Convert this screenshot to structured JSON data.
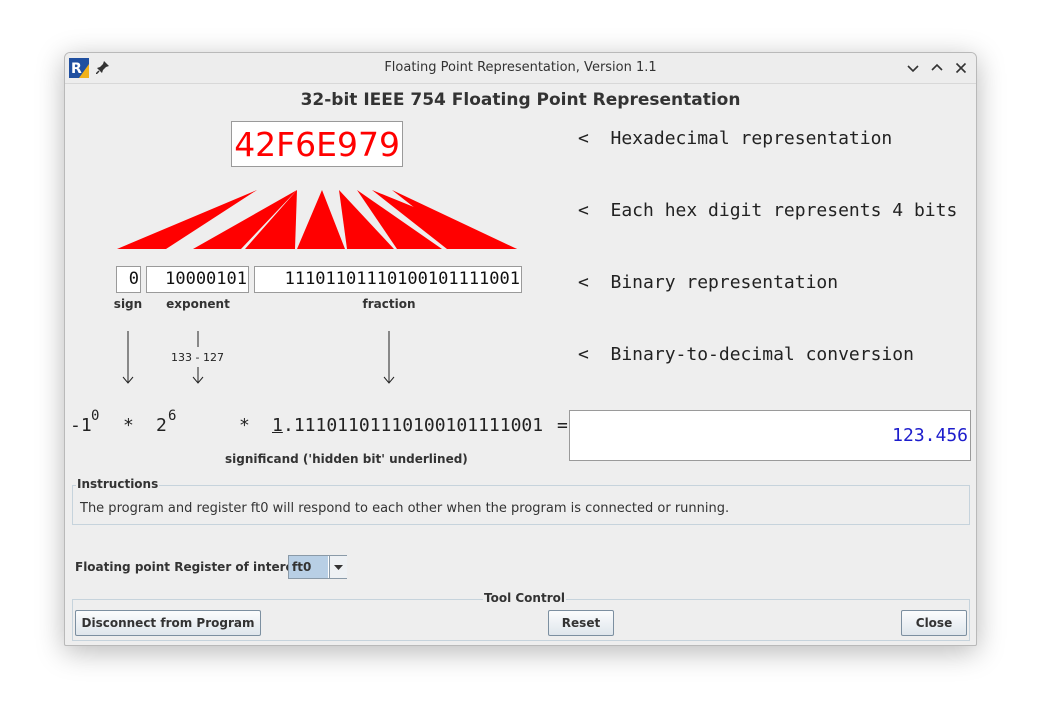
{
  "window": {
    "title": "Floating Point Representation, Version 1.1"
  },
  "heading": "32-bit IEEE 754 Floating Point Representation",
  "hex_value": "42F6E979",
  "bits": {
    "sign": "0",
    "exponent": "10000101",
    "fraction": "11101101110100101111001"
  },
  "bit_labels": {
    "sign": "sign",
    "exponent": "exponent",
    "fraction": "fraction"
  },
  "exponent_calc": "133 - 127",
  "row_labels": {
    "hex": "<  Hexadecimal representation",
    "digits": "<  Each hex digit represents 4 bits",
    "binary": "<  Binary representation",
    "conversion": "<  Binary-to-decimal conversion"
  },
  "formula": {
    "sign_base": "-1",
    "sign_exp": "0",
    "times1": "*",
    "two_base": "2",
    "two_exp": "6",
    "times2": "*",
    "hidden_bit": "1",
    "significand_rest": ".11101101110100101111001",
    "equals": "="
  },
  "result_value": "123.456",
  "significand_caption": "significand ('hidden bit' underlined)",
  "instructions": {
    "title": "Instructions",
    "text": "The program and register ft0 will respond to each other when the program is connected or running."
  },
  "register": {
    "label": "Floating point Register of interest:",
    "value": "ft0"
  },
  "tool_control": {
    "title": "Tool Control",
    "disconnect_label": "Disconnect from Program",
    "reset_label": "Reset",
    "close_label": "Close"
  },
  "colors": {
    "hex_text": "#ff0000",
    "fan": "#ff0000",
    "result_text": "#1d1dcc",
    "combo_selected": "#b8cfe5"
  }
}
